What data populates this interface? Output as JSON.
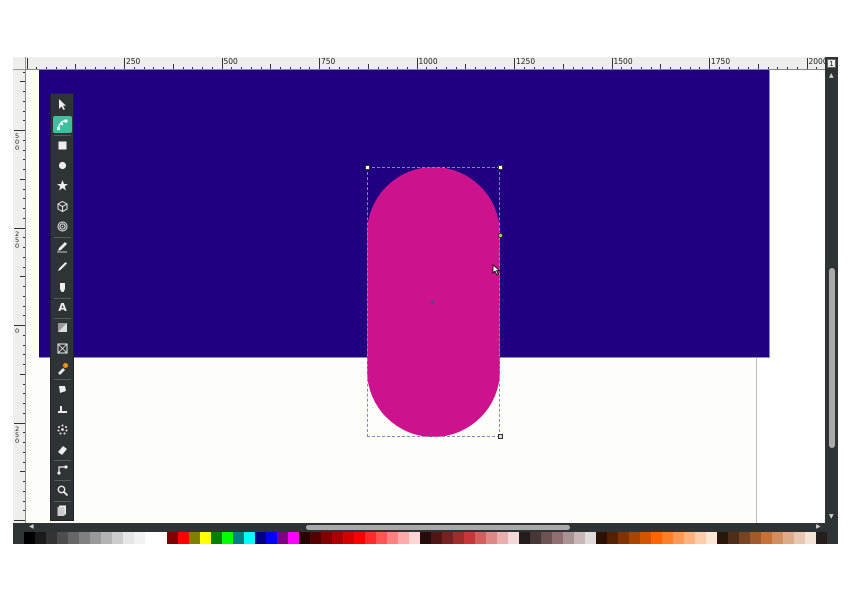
{
  "ruler": {
    "h_labels": [
      "250",
      "500",
      "750",
      "1000",
      "1250",
      "1500",
      "1750",
      "2000"
    ],
    "v_labels": [
      "500",
      "250",
      "0",
      "250"
    ]
  },
  "canvas": {
    "rect_fill": "#200080",
    "pill_fill": "#cc138d",
    "page_bg": "#fdfdf9"
  },
  "tools": [
    {
      "name": "selector-tool",
      "icon": "arrow-icon",
      "active": false
    },
    {
      "name": "node-tool",
      "icon": "node-icon",
      "active": true
    },
    {
      "name": "rect-tool",
      "icon": "square-icon",
      "active": false
    },
    {
      "name": "ellipse-tool",
      "icon": "circle-icon",
      "active": false
    },
    {
      "name": "star-tool",
      "icon": "star-icon",
      "active": false
    },
    {
      "name": "3dbox-tool",
      "icon": "cube-icon",
      "active": false
    },
    {
      "name": "spiral-tool",
      "icon": "spiral-icon",
      "active": false
    },
    {
      "name": "pencil-tool",
      "icon": "pencil-icon",
      "active": false
    },
    {
      "name": "pen-tool",
      "icon": "pen-icon",
      "active": false
    },
    {
      "name": "calligraphy-tool",
      "icon": "calligraphy-icon",
      "active": false
    },
    {
      "name": "text-tool",
      "icon": "text-icon",
      "label": "A",
      "active": false
    },
    {
      "name": "gradient-tool",
      "icon": "gradient-icon",
      "active": false
    },
    {
      "name": "mesh-tool",
      "icon": "mesh-icon",
      "active": false
    },
    {
      "name": "dropper-tool",
      "icon": "dropper-icon",
      "active": false
    },
    {
      "name": "bucket-tool",
      "icon": "paint-bucket-icon",
      "active": false
    },
    {
      "name": "tweak-tool",
      "icon": "tweak-icon",
      "active": false
    },
    {
      "name": "spray-tool",
      "icon": "spray-icon",
      "active": false
    },
    {
      "name": "eraser-tool",
      "icon": "eraser-icon",
      "active": false
    },
    {
      "name": "connector-tool",
      "icon": "connector-icon",
      "active": false
    },
    {
      "name": "zoom-tool",
      "icon": "magnifier-icon",
      "active": false
    },
    {
      "name": "pages-tool",
      "icon": "pages-icon",
      "active": false
    }
  ],
  "palette": [
    "#2e3436",
    "#000000",
    "#1a1a1a",
    "#333333",
    "#4d4d4d",
    "#666666",
    "#808080",
    "#999999",
    "#b3b3b3",
    "#cccccc",
    "#e6e6e6",
    "#f2f2f2",
    "#ffffff",
    "#ffffff",
    "#800000",
    "#ff0000",
    "#808000",
    "#ffff00",
    "#008000",
    "#00ff00",
    "#008080",
    "#00ffff",
    "#000080",
    "#0000ff",
    "#800080",
    "#ff00ff",
    "#2b0000",
    "#550000",
    "#800000",
    "#aa0000",
    "#d40000",
    "#ff0000",
    "#ff2a2a",
    "#ff5555",
    "#ff8080",
    "#ffaaaa",
    "#ffd5d5",
    "#280b0b",
    "#501616",
    "#782121",
    "#a02c2c",
    "#c83737",
    "#d35f5f",
    "#de8787",
    "#e9afaf",
    "#f4d7d7",
    "#241c1c",
    "#483737",
    "#6c5353",
    "#916f6f",
    "#ac9393",
    "#c8b7b7",
    "#e3dbdb",
    "#2b1100",
    "#552200",
    "#803300",
    "#aa4400",
    "#d45500",
    "#ff6600",
    "#ff7f2a",
    "#ff9955",
    "#ffb380",
    "#ffccaa",
    "#ffe6d5",
    "#28170b",
    "#502d16",
    "#784421",
    "#a05a2c",
    "#c87137",
    "#d38d5f",
    "#deaa87",
    "#e9c6af",
    "#f4e3d7",
    "#241f1c",
    "#2e3436"
  ]
}
